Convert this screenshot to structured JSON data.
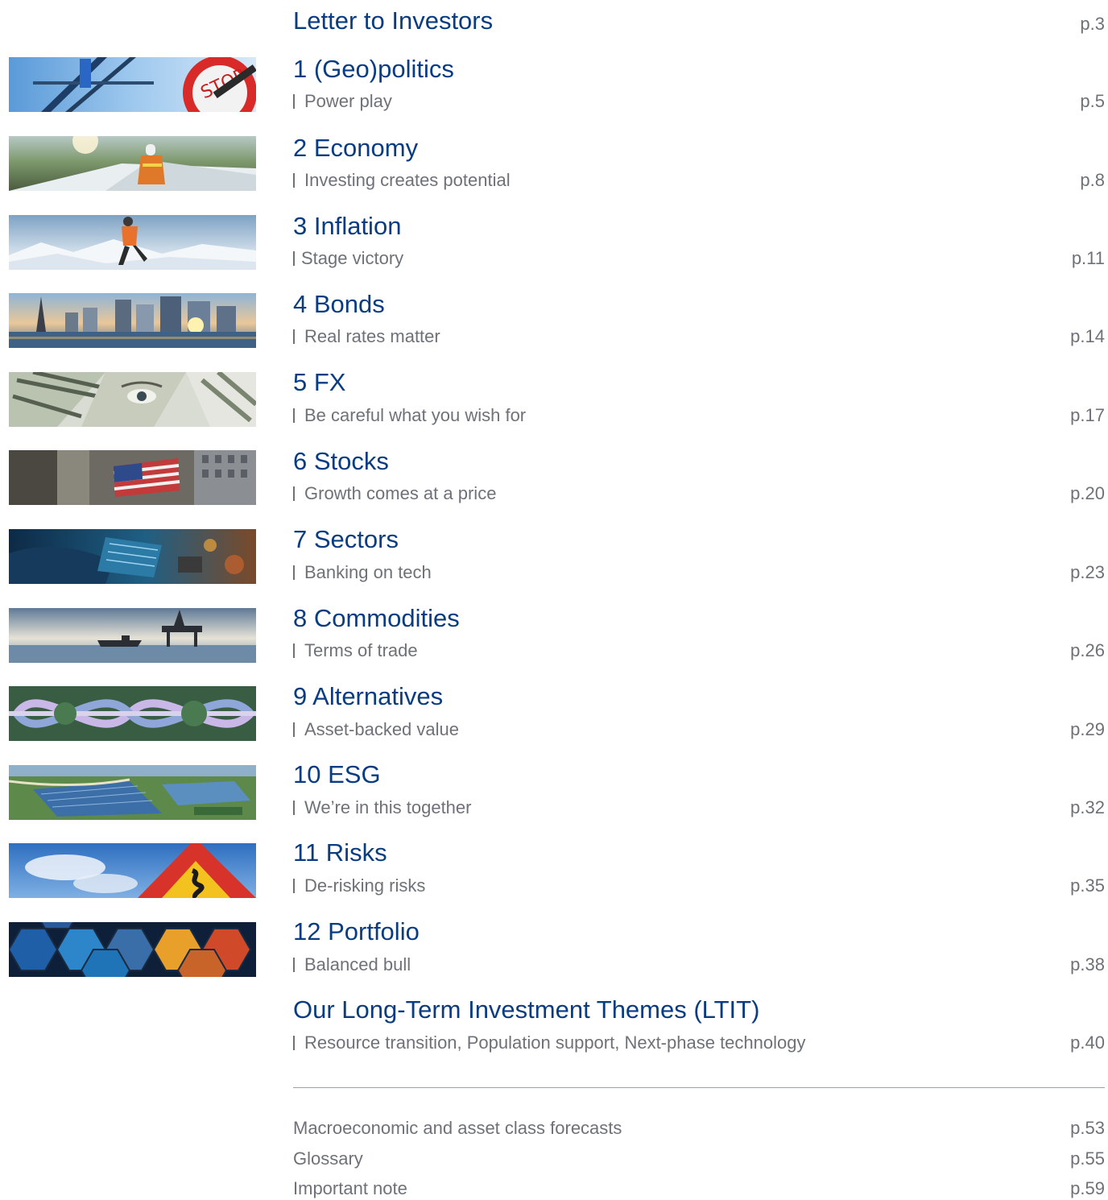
{
  "letter": {
    "title": "Letter to Investors",
    "page": "p.3"
  },
  "chapters": [
    {
      "title": "1 (Geo)politics",
      "subtitle": "Power play",
      "page": "p.5",
      "image_icon": "stop-sign-image"
    },
    {
      "title": "2 Economy",
      "subtitle": "Investing creates potential",
      "page": "p.8",
      "image_icon": "wind-turbine-worker-image"
    },
    {
      "title": "3 Inflation",
      "subtitle": "Stage victory",
      "page": "p.11",
      "image_icon": "runner-snow-image"
    },
    {
      "title": "4 Bonds",
      "subtitle": "Real rates matter",
      "page": "p.14",
      "image_icon": "city-skyline-image"
    },
    {
      "title": "5 FX",
      "subtitle": "Be careful what you wish for",
      "page": "p.17",
      "image_icon": "dollar-bill-image"
    },
    {
      "title": "6 Stocks",
      "subtitle": "Growth comes at a price",
      "page": "p.20",
      "image_icon": "wall-street-flag-image"
    },
    {
      "title": "7 Sectors",
      "subtitle": "Banking on tech",
      "page": "p.23",
      "image_icon": "tech-circuit-image"
    },
    {
      "title": "8 Commodities",
      "subtitle": "Terms of trade",
      "page": "p.26",
      "image_icon": "oil-platform-image"
    },
    {
      "title": "9 Alternatives",
      "subtitle": "Asset-backed value",
      "page": "p.29",
      "image_icon": "highway-interchange-image"
    },
    {
      "title": "10 ESG",
      "subtitle": "We’re in this together",
      "page": "p.32",
      "image_icon": "solar-farm-image"
    },
    {
      "title": "11 Risks",
      "subtitle": "De-risking risks",
      "page": "p.35",
      "image_icon": "winding-road-sign-image"
    },
    {
      "title": "12 Portfolio",
      "subtitle": "Balanced bull",
      "page": "p.38",
      "image_icon": "hexagon-pattern-image"
    }
  ],
  "ltit": {
    "title": "Our Long-Term Investment Themes (LTIT)",
    "subtitle": "Resource transition, Population support, Next-phase technology",
    "page": "p.40"
  },
  "appendix": [
    {
      "label": "Macroeconomic and asset class forecasts",
      "page": "p.53"
    },
    {
      "label": "Glossary",
      "page": "p.55"
    },
    {
      "label": "Important note",
      "page": "p.59"
    }
  ],
  "colors": {
    "title_blue": "#0a3c82",
    "subtitle_gray": "#6e7278",
    "divider_gray": "#9aa0a6"
  }
}
